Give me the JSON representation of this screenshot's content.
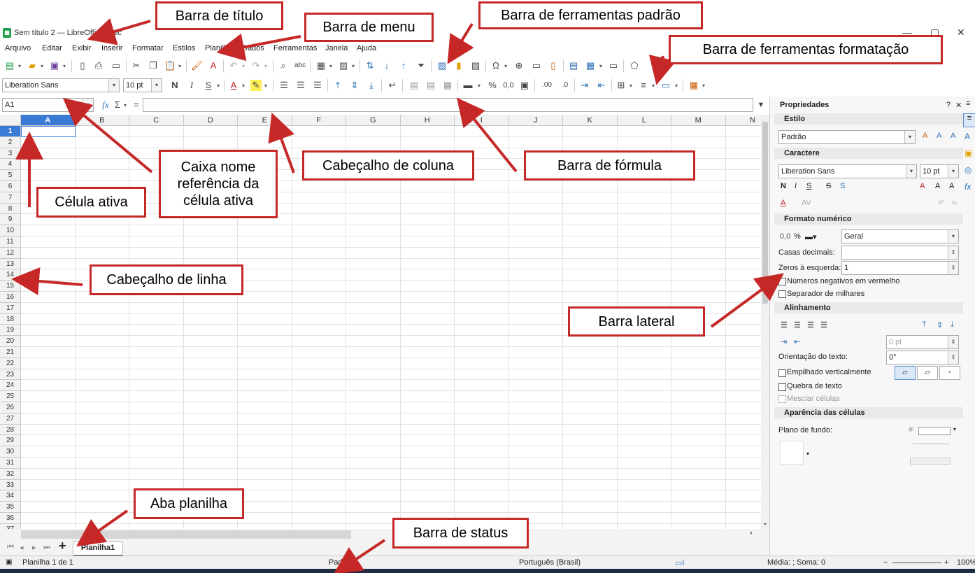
{
  "title_bar": {
    "title": "Sem título 2 — LibreOffice Calc"
  },
  "menu": [
    "Arquivo",
    "Editar",
    "Exibir",
    "Inserir",
    "Formatar",
    "Estilos",
    "Planilha",
    "Dados",
    "Ferramentas",
    "Janela",
    "Ajuda"
  ],
  "format_toolbar": {
    "font_name": "Liberation Sans",
    "font_size": "10 pt",
    "bold": "N",
    "italic": "I",
    "underline": "S",
    "percent": "%",
    "decimal": "0,0"
  },
  "formula_bar": {
    "name_box": "A1",
    "formula_value": ""
  },
  "columns": [
    "A",
    "B",
    "C",
    "D",
    "E",
    "F",
    "G",
    "H",
    "I",
    "J",
    "K",
    "L",
    "M",
    "N"
  ],
  "rows": [
    "1",
    "2",
    "3",
    "4",
    "5",
    "6",
    "7",
    "8",
    "9",
    "10",
    "11",
    "12",
    "13",
    "14",
    "15",
    "16",
    "17",
    "18",
    "19",
    "20",
    "21",
    "22",
    "23",
    "24",
    "25",
    "26",
    "27",
    "28",
    "29",
    "30",
    "31",
    "32",
    "33",
    "34",
    "35",
    "36",
    "37"
  ],
  "sheet_tabs": {
    "active": "Planilha1"
  },
  "sidebar": {
    "title": "Propriedades",
    "style_section": "Estilo",
    "style_value": "Padrão",
    "char_section": "Caractere",
    "char_font": "Liberation Sans",
    "char_size": "10 pt",
    "numformat_section": "Formato numérico",
    "numformat_value": "Geral",
    "decimal_places_label": "Casas decimais:",
    "leading_zeros_label": "Zeros à esquerda:",
    "leading_zeros_value": "1",
    "neg_red_label": "Números negativos em vermelho",
    "thousands_label": "Separador de milhares",
    "align_section": "Alinhamento",
    "indent_value": "0 pt",
    "orientation_label": "Orientação do texto:",
    "orientation_value": "0°",
    "stacked_label": "Empilhado verticalmente",
    "wrap_label": "Quebra de texto",
    "merge_label": "Mesclar células",
    "appearance_section": "Aparência das células",
    "background_label": "Plano de fundo:"
  },
  "status_bar": {
    "sheet_info": "Planilha 1 de 1",
    "page_style": "Padrão",
    "language": "Português (Brasil)",
    "sum_info": "Média: ; Soma: 0",
    "zoom": "100%"
  },
  "callouts": {
    "title_bar": "Barra de título",
    "menu_bar": "Barra de menu",
    "standard_toolbar": "Barra de ferramentas padrão",
    "format_toolbar": "Barra de ferramentas formatação",
    "name_box_line1": "Caixa nome",
    "name_box_line2": "referência da",
    "name_box_line3": "célula ativa",
    "active_cell": "Célula ativa",
    "column_header": "Cabeçalho de coluna",
    "formula_bar": "Barra de fórmula",
    "row_header": "Cabeçalho de linha",
    "sidebar": "Barra lateral",
    "sheet_tab": "Aba planilha",
    "status_bar": "Barra de status"
  },
  "colors": {
    "accent": "#c62828",
    "active_cell_border": "#3a7bd5",
    "green_icon": "#1d9e48"
  }
}
